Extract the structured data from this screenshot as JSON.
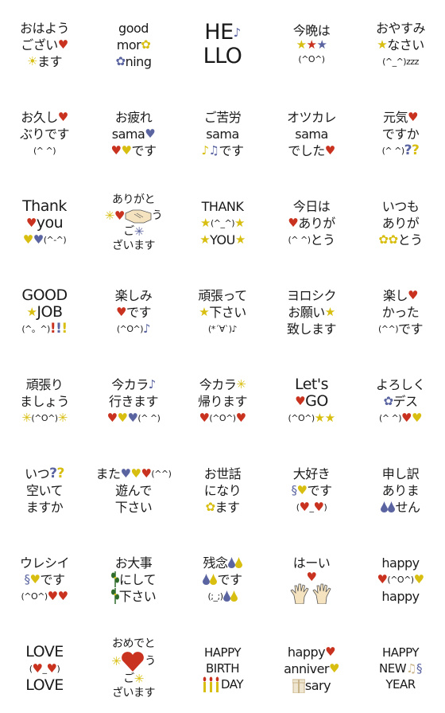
{
  "colors": {
    "red": "#c8321e",
    "yellow": "#d8be10",
    "blue": "#5a64a0",
    "green": "#2f6b2a",
    "skin": "#f5e3c0",
    "tan": "#c9b48a"
  },
  "stickers": [
    {
      "lines": [
        [
          {
            "text": "おはよう"
          }
        ],
        [
          {
            "text": "ござい"
          },
          {
            "icon": "heart",
            "color": "red"
          }
        ],
        [
          {
            "icon": "sun",
            "color": "yellow"
          },
          {
            "text": " ます"
          }
        ]
      ]
    },
    {
      "lines": [
        [
          {
            "text": "good"
          }
        ],
        [
          {
            "text": "mor"
          },
          {
            "icon": "flower",
            "color": "yellow"
          }
        ],
        [
          {
            "icon": "flower",
            "color": "blue"
          },
          {
            "text": "ning"
          }
        ]
      ]
    },
    {
      "lines": [
        [
          {
            "text": "HE"
          },
          {
            "icon": "note",
            "color": "blue"
          }
        ],
        [
          {
            "text": "LLO"
          }
        ]
      ]
    },
    {
      "lines": [
        [
          {
            "text": "今晩は"
          }
        ],
        [
          {
            "icon": "star",
            "color": "yellow"
          },
          {
            "icon": "star",
            "color": "red"
          },
          {
            "icon": "star",
            "color": "blue"
          }
        ],
        [
          {
            "text": "(^O^)",
            "small": true
          }
        ]
      ]
    },
    {
      "lines": [
        [
          {
            "text": "おやすみ"
          }
        ],
        [
          {
            "icon": "star",
            "color": "yellow"
          },
          {
            "text": "なさい"
          }
        ],
        [
          {
            "text": "(^_^)zzz",
            "small": true
          }
        ]
      ]
    },
    {
      "lines": [
        [
          {
            "text": "お久し"
          },
          {
            "icon": "heart",
            "color": "red"
          }
        ],
        [
          {
            "text": "ぶりです"
          }
        ],
        [
          {
            "text": "(^ ^)",
            "small": true
          }
        ]
      ]
    },
    {
      "lines": [
        [
          {
            "text": "お疲れ"
          }
        ],
        [
          {
            "text": "sama"
          },
          {
            "icon": "heart",
            "color": "blue"
          }
        ],
        [
          {
            "icon": "heart",
            "color": "red"
          },
          {
            "icon": "heart",
            "color": "yellow"
          },
          {
            "text": "です"
          }
        ]
      ]
    },
    {
      "lines": [
        [
          {
            "text": "ご苦労"
          }
        ],
        [
          {
            "text": "sama"
          }
        ],
        [
          {
            "icon": "note",
            "color": "yellow"
          },
          {
            "icon": "beamed-note",
            "color": "blue"
          },
          {
            "text": "です"
          }
        ]
      ]
    },
    {
      "lines": [
        [
          {
            "text": "オツカレ"
          }
        ],
        [
          {
            "text": "sama"
          }
        ],
        [
          {
            "text": "でした"
          },
          {
            "icon": "heart",
            "color": "red"
          }
        ]
      ]
    },
    {
      "lines": [
        [
          {
            "text": "元気 "
          },
          {
            "icon": "heart",
            "color": "red"
          }
        ],
        [
          {
            "text": "ですか"
          }
        ],
        [
          {
            "text": "(^ ^)",
            "small": true
          },
          {
            "icon": "question",
            "color": "blue"
          },
          {
            "icon": "question",
            "color": "yellow"
          }
        ]
      ]
    },
    {
      "lines": [
        [
          {
            "text": "Thank"
          }
        ],
        [
          {
            "icon": "heart",
            "color": "red"
          },
          {
            "text": " you"
          }
        ],
        [
          {
            "icon": "heart",
            "color": "yellow"
          },
          {
            "icon": "heart",
            "color": "blue"
          },
          {
            "text": "(^-^)",
            "small": true
          }
        ]
      ]
    },
    {
      "lines": [
        [
          {
            "text": "ありがと"
          }
        ],
        [
          {
            "icon": "asterisk",
            "color": "yellow"
          },
          {
            "icon": "heart",
            "color": "red"
          },
          {
            "icon": "handshake",
            "color": "skin"
          },
          {
            "text": "う"
          }
        ],
        [
          {
            "text": "ご"
          },
          {
            "icon": "asterisk",
            "color": "blue"
          }
        ],
        [
          {
            "text": "ざいます"
          }
        ]
      ]
    },
    {
      "lines": [
        [
          {
            "text": "THANK"
          }
        ],
        [
          {
            "icon": "star",
            "color": "yellow"
          },
          {
            "text": "(^_^)",
            "small": true
          },
          {
            "icon": "star",
            "color": "yellow"
          }
        ],
        [
          {
            "icon": "star",
            "color": "yellow"
          },
          {
            "text": "YOU"
          },
          {
            "icon": "star",
            "color": "yellow"
          }
        ]
      ]
    },
    {
      "lines": [
        [
          {
            "text": "今日は"
          }
        ],
        [
          {
            "icon": "heart",
            "color": "red"
          },
          {
            "text": "ありが"
          }
        ],
        [
          {
            "text": "(^ ^)",
            "small": true
          },
          {
            "text": "とう"
          }
        ]
      ]
    },
    {
      "lines": [
        [
          {
            "text": "いつも"
          }
        ],
        [
          {
            "text": "ありが"
          }
        ],
        [
          {
            "icon": "flower",
            "color": "yellow"
          },
          {
            "icon": "flower",
            "color": "yellow"
          },
          {
            "text": "とう"
          }
        ]
      ]
    },
    {
      "lines": [
        [
          {
            "text": "GOOD"
          }
        ],
        [
          {
            "icon": "star",
            "color": "yellow"
          },
          {
            "text": " JOB"
          }
        ],
        [
          {
            "text": "(^。^)",
            "small": true
          },
          {
            "icon": "exclamation",
            "color": "red"
          },
          {
            "icon": "exclamation",
            "color": "blue"
          },
          {
            "icon": "exclamation",
            "color": "yellow"
          }
        ]
      ]
    },
    {
      "lines": [
        [
          {
            "text": "楽しみ"
          }
        ],
        [
          {
            "icon": "heart",
            "color": "red"
          },
          {
            "text": " です"
          }
        ],
        [
          {
            "text": "(^O^)",
            "small": true
          },
          {
            "icon": "note",
            "color": "blue"
          }
        ]
      ]
    },
    {
      "lines": [
        [
          {
            "text": "頑張って"
          }
        ],
        [
          {
            "icon": "star",
            "color": "yellow"
          },
          {
            "text": "下さい"
          }
        ],
        [
          {
            "text": "(*´∀`)♪",
            "small": true
          }
        ]
      ]
    },
    {
      "lines": [
        [
          {
            "text": "ヨロシク"
          }
        ],
        [
          {
            "text": "お願い"
          },
          {
            "icon": "star",
            "color": "yellow"
          }
        ],
        [
          {
            "text": "致します"
          }
        ]
      ]
    },
    {
      "lines": [
        [
          {
            "text": "楽し "
          },
          {
            "icon": "heart",
            "color": "red"
          }
        ],
        [
          {
            "text": "かった"
          }
        ],
        [
          {
            "text": "(^^)",
            "small": true
          },
          {
            "text": " です"
          }
        ]
      ]
    },
    {
      "lines": [
        [
          {
            "text": "頑張り"
          }
        ],
        [
          {
            "text": "ましょう"
          }
        ],
        [
          {
            "icon": "asterisk",
            "color": "yellow"
          },
          {
            "text": "(^O^)",
            "small": true
          },
          {
            "icon": "asterisk",
            "color": "yellow"
          }
        ]
      ]
    },
    {
      "lines": [
        [
          {
            "text": "今カラ"
          },
          {
            "icon": "note",
            "color": "blue"
          }
        ],
        [
          {
            "text": "行きます"
          }
        ],
        [
          {
            "icon": "heart",
            "color": "red"
          },
          {
            "icon": "heart",
            "color": "yellow"
          },
          {
            "icon": "heart",
            "color": "blue"
          },
          {
            "text": "(^ ^)",
            "small": true
          }
        ]
      ]
    },
    {
      "lines": [
        [
          {
            "text": "今カラ"
          },
          {
            "icon": "asterisk",
            "color": "yellow"
          }
        ],
        [
          {
            "text": "帰ります"
          }
        ],
        [
          {
            "icon": "heart",
            "color": "red"
          },
          {
            "text": "(^O^)",
            "small": true
          },
          {
            "icon": "heart",
            "color": "red"
          }
        ]
      ]
    },
    {
      "lines": [
        [
          {
            "text": "Let's"
          }
        ],
        [
          {
            "icon": "heart",
            "color": "red"
          },
          {
            "text": " GO"
          }
        ],
        [
          {
            "text": "(^O^)",
            "small": true
          },
          {
            "icon": "star",
            "color": "yellow"
          },
          {
            "icon": "star",
            "color": "yellow"
          }
        ]
      ]
    },
    {
      "lines": [
        [
          {
            "text": "よろしく"
          }
        ],
        [
          {
            "icon": "flower",
            "color": "blue"
          },
          {
            "text": " デス"
          }
        ],
        [
          {
            "text": "(^ ^)",
            "small": true
          },
          {
            "icon": "heart",
            "color": "red"
          },
          {
            "icon": "heart",
            "color": "yellow"
          }
        ]
      ]
    },
    {
      "lines": [
        [
          {
            "text": "いつ"
          },
          {
            "icon": "question",
            "color": "blue"
          },
          {
            "icon": "question",
            "color": "yellow"
          }
        ],
        [
          {
            "text": "空いて"
          }
        ],
        [
          {
            "text": "ますか"
          }
        ]
      ]
    },
    {
      "lines": [
        [
          {
            "text": "また"
          },
          {
            "icon": "heart",
            "color": "blue"
          },
          {
            "icon": "heart",
            "color": "yellow"
          },
          {
            "icon": "heart",
            "color": "red"
          },
          {
            "text": "(^^)",
            "small": true
          }
        ],
        [
          {
            "text": "遊んで"
          }
        ],
        [
          {
            "text": "下さい"
          }
        ]
      ]
    },
    {
      "lines": [
        [
          {
            "text": "お世話"
          }
        ],
        [
          {
            "text": "になり"
          }
        ],
        [
          {
            "icon": "flower",
            "color": "yellow"
          },
          {
            "text": " ます"
          }
        ]
      ]
    },
    {
      "lines": [
        [
          {
            "text": "大好き"
          }
        ],
        [
          {
            "icon": "treble-clef",
            "color": "blue"
          },
          {
            "icon": "heart",
            "color": "yellow"
          },
          {
            "text": "です"
          }
        ],
        [
          {
            "text": "(",
            "small": true
          },
          {
            "icon": "heart",
            "color": "red"
          },
          {
            "text": "_",
            "small": true
          },
          {
            "icon": "heart",
            "color": "red"
          },
          {
            "text": ")",
            "small": true
          }
        ]
      ]
    },
    {
      "lines": [
        [
          {
            "text": "申し訳"
          }
        ],
        [
          {
            "text": "ありま"
          }
        ],
        [
          {
            "icon": "drop",
            "color": "blue"
          },
          {
            "icon": "drop",
            "color": "blue"
          },
          {
            "text": "せん"
          }
        ]
      ]
    },
    {
      "lines": [
        [
          {
            "text": "ウレシイ"
          }
        ],
        [
          {
            "icon": "treble-clef",
            "color": "blue"
          },
          {
            "icon": "heart",
            "color": "yellow"
          },
          {
            "text": "です"
          }
        ],
        [
          {
            "text": "(^O^)",
            "small": true
          },
          {
            "icon": "heart",
            "color": "red"
          },
          {
            "icon": "heart",
            "color": "red"
          }
        ]
      ]
    },
    {
      "lines": [
        [
          {
            "text": "お大事"
          }
        ],
        [
          {
            "icon": "leaf",
            "color": "green"
          },
          {
            "text": "にして"
          }
        ],
        [
          {
            "icon": "leaf",
            "color": "green"
          },
          {
            "text": "下さい"
          }
        ]
      ]
    },
    {
      "lines": [
        [
          {
            "text": "残念"
          },
          {
            "icon": "drop",
            "color": "blue"
          },
          {
            "icon": "drop",
            "color": "yellow"
          }
        ],
        [
          {
            "icon": "drop",
            "color": "blue"
          },
          {
            "icon": "drop",
            "color": "yellow"
          },
          {
            "text": " です"
          }
        ],
        [
          {
            "text": "(;_;)",
            "small": true
          },
          {
            "icon": "drop",
            "color": "blue"
          },
          {
            "icon": "drop",
            "color": "yellow"
          }
        ]
      ]
    },
    {
      "lines": [
        [
          {
            "text": "はーい"
          }
        ],
        [
          {
            "icon": "heart",
            "color": "red"
          }
        ],
        [
          {
            "icon": "hand",
            "color": "skin"
          },
          {
            "icon": "hand",
            "color": "skin"
          }
        ]
      ]
    },
    {
      "lines": [
        [
          {
            "text": "happy"
          }
        ],
        [
          {
            "icon": "heart",
            "color": "red"
          },
          {
            "text": "(^O^)",
            "small": true
          },
          {
            "icon": "heart",
            "color": "yellow"
          }
        ],
        [
          {
            "text": "happy"
          }
        ]
      ]
    },
    {
      "lines": [
        [
          {
            "text": "LOVE"
          }
        ],
        [
          {
            "text": "(",
            "small": true
          },
          {
            "icon": "heart",
            "color": "red"
          },
          {
            "text": "_",
            "small": true
          },
          {
            "icon": "heart",
            "color": "red"
          },
          {
            "text": ")",
            "small": true
          }
        ],
        [
          {
            "text": "LOVE"
          }
        ]
      ]
    },
    {
      "lines": [
        [
          {
            "text": "おめでと"
          }
        ],
        [
          {
            "icon": "asterisk",
            "color": "yellow"
          },
          {
            "icon": "big-heart",
            "color": "red"
          },
          {
            "text": "う"
          }
        ],
        [
          {
            "text": "ご"
          },
          {
            "icon": "asterisk",
            "color": "yellow"
          }
        ],
        [
          {
            "text": "ざいます"
          }
        ]
      ]
    },
    {
      "lines": [
        [
          {
            "text": "HAPPY"
          }
        ],
        [
          {
            "text": "BIRTH"
          }
        ],
        [
          {
            "icon": "candles",
            "color": "yellow"
          },
          {
            "text": " DAY"
          }
        ]
      ]
    },
    {
      "lines": [
        [
          {
            "text": "happy"
          },
          {
            "icon": "heart",
            "color": "red"
          }
        ],
        [
          {
            "text": "anniver"
          },
          {
            "icon": "heart",
            "color": "yellow"
          }
        ],
        [
          {
            "icon": "gift",
            "color": "tan"
          },
          {
            "text": " sary"
          }
        ]
      ]
    },
    {
      "lines": [
        [
          {
            "text": "HAPPY"
          }
        ],
        [
          {
            "text": "NEW"
          },
          {
            "icon": "beamed-note",
            "color": "tan"
          },
          {
            "icon": "treble-clef",
            "color": "blue"
          }
        ],
        [
          {
            "text": "YEAR"
          }
        ]
      ]
    }
  ]
}
